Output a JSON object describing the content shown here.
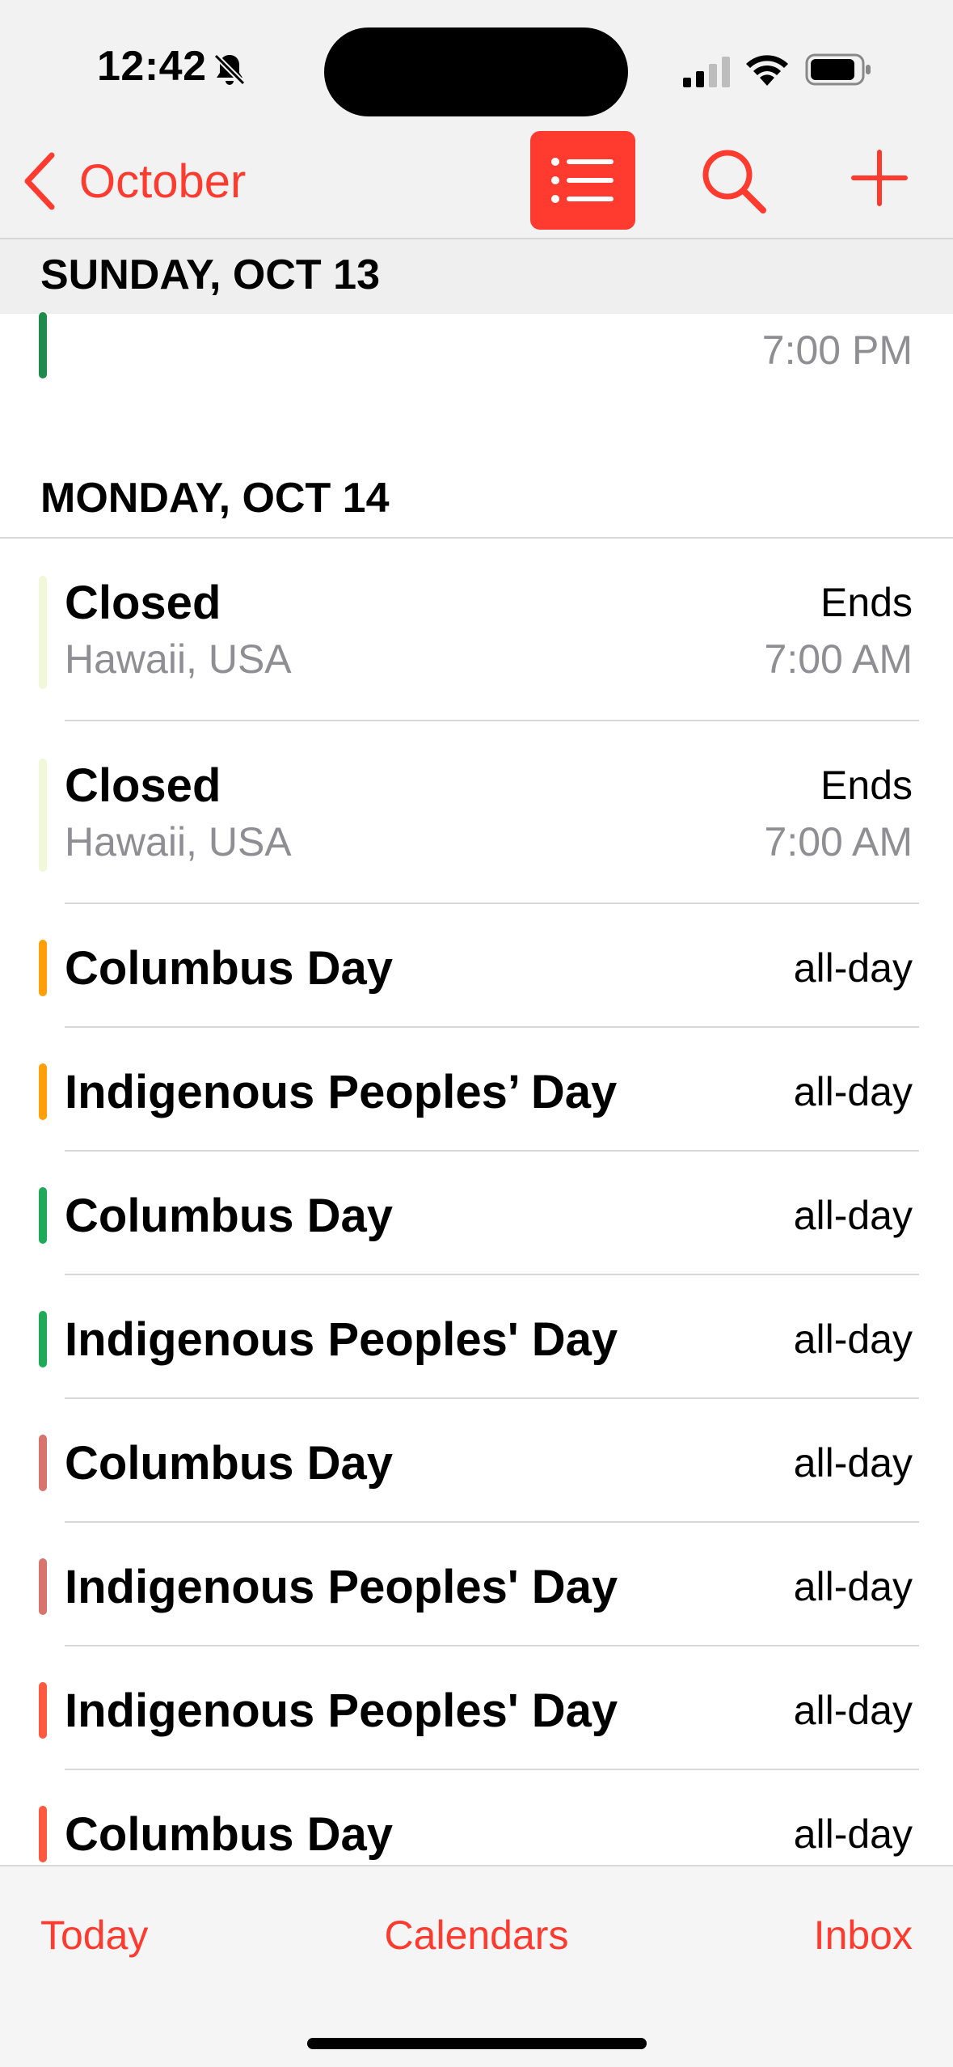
{
  "status_bar": {
    "time": "12:42",
    "icons": [
      "bell-slash-icon",
      "cellular-signal-icon",
      "wifi-icon",
      "battery-icon"
    ]
  },
  "nav": {
    "back_label": "October",
    "buttons": [
      "chevron-left-icon",
      "list-view-icon",
      "search-icon",
      "add-icon"
    ],
    "accent_color": "#FF3B30"
  },
  "sections": [
    {
      "header": "SUNDAY, OCT 13",
      "events": [
        {
          "title": "",
          "time": "7:00 PM",
          "color": "#1E8A4C"
        }
      ]
    },
    {
      "header": "MONDAY, OCT 14",
      "events": [
        {
          "title": "Closed",
          "location": "Hawaii, USA",
          "time_label": "Ends",
          "time": "7:00 AM",
          "color": "#F1F7D9"
        },
        {
          "title": "Closed",
          "location": "Hawaii, USA",
          "time_label": "Ends",
          "time": "7:00 AM",
          "color": "#F1F7D9"
        },
        {
          "title": "Columbus Day",
          "time": "all-day",
          "color": "#FF9F0A"
        },
        {
          "title": "Indigenous Peoples’ Day",
          "time": "all-day",
          "color": "#FF9F0A"
        },
        {
          "title": "Columbus Day",
          "time": "all-day",
          "color": "#1FAA5A"
        },
        {
          "title": "Indigenous Peoples' Day",
          "time": "all-day",
          "color": "#1FAA5A"
        },
        {
          "title": "Columbus Day",
          "time": "all-day",
          "color": "#D6746D"
        },
        {
          "title": "Indigenous Peoples' Day",
          "time": "all-day",
          "color": "#D6746D"
        },
        {
          "title": "Indigenous Peoples' Day",
          "time": "all-day",
          "color": "#FF5A40"
        },
        {
          "title": "Columbus Day",
          "time": "all-day",
          "color": "#FF5A40"
        }
      ]
    }
  ],
  "tab_bar": {
    "today": "Today",
    "calendars": "Calendars",
    "inbox": "Inbox"
  }
}
